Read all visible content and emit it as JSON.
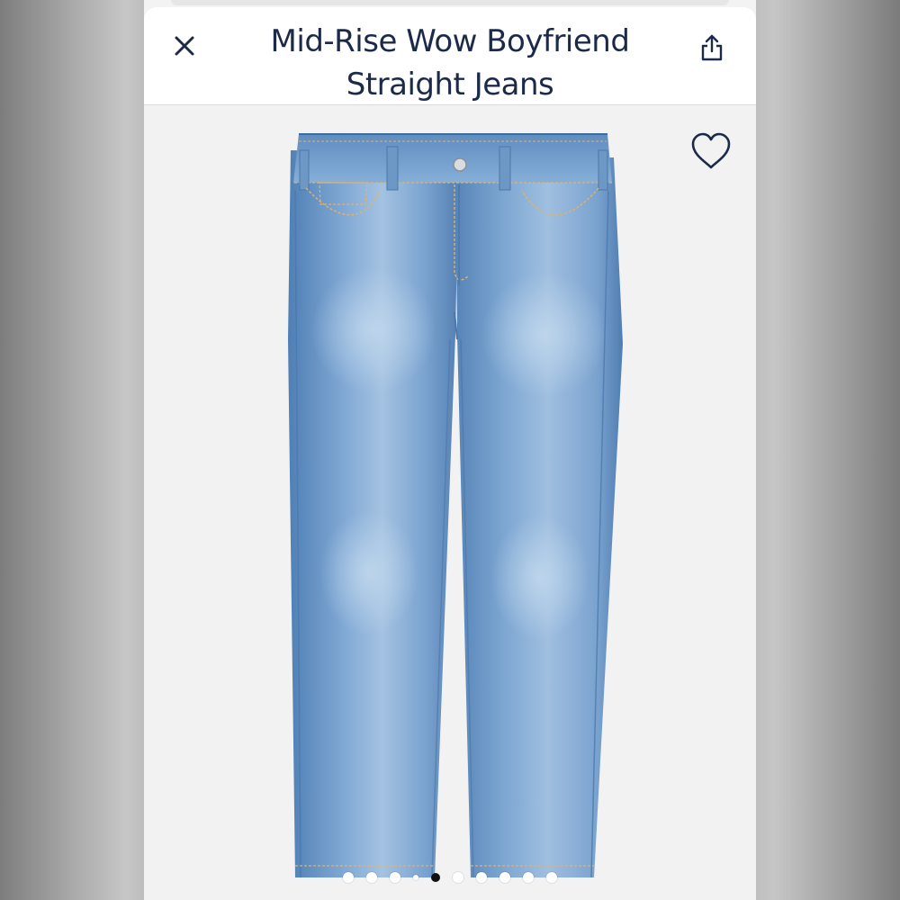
{
  "header": {
    "title": "Mid-Rise Wow Boyfriend Straight Jeans",
    "close_icon": "close-icon",
    "share_icon": "share-icon"
  },
  "product_image": {
    "favorite_icon": "heart-outline-icon",
    "carousel": {
      "total": 10,
      "active_index": 4
    }
  },
  "colors": {
    "title": "#1c2a4a",
    "denim": "#6e9ccc",
    "background": "#f2f2f2"
  }
}
